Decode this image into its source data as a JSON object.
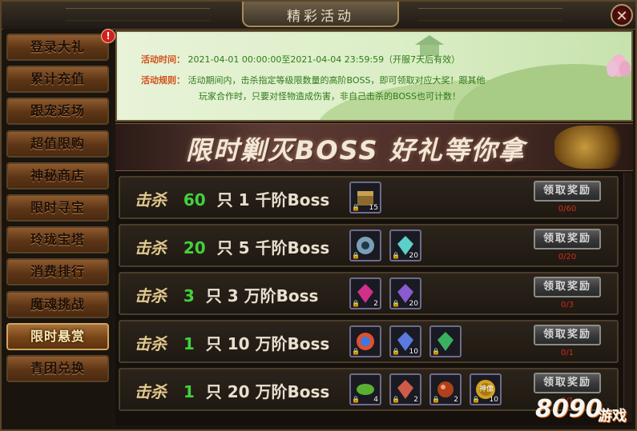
{
  "window": {
    "title": "精彩活动",
    "close_label": "✕"
  },
  "sidebar": {
    "alert": "!",
    "items": [
      {
        "label": "登录大礼"
      },
      {
        "label": "累计充值"
      },
      {
        "label": "跟宠返场"
      },
      {
        "label": "超值限购"
      },
      {
        "label": "神秘商店"
      },
      {
        "label": "限时寻宝"
      },
      {
        "label": "玲珑宝塔"
      },
      {
        "label": "消费排行"
      },
      {
        "label": "魔魂挑战"
      },
      {
        "label": "限时悬赏"
      },
      {
        "label": "青团兑换"
      }
    ],
    "active_index": 9
  },
  "info": {
    "time_label": "活动时间：",
    "time_value": "2021-04-01 00:00:00至2021-04-04 23:59:59（开服7天后有效）",
    "rule_label": "活动规则：",
    "rule_line1_a": "活动期间内，击杀指定等级限数量的高阶BOSS，即可领取对应大奖！",
    "rule_line1_b": "跟其他",
    "rule_line2": "玩家合作时，只要对怪物造成伤害，非自己击杀的BOSS也可计数！"
  },
  "banner": {
    "title": "限时剿灭BOSS  好礼等你拿"
  },
  "rewards": [
    {
      "kill": "击杀",
      "count": "60",
      "unit": "只",
      "level": "1",
      "tier": "千阶Boss",
      "button": "领取奖励",
      "progress": "0/60",
      "items": [
        {
          "icon": "treasure-chest-icon",
          "count": "15",
          "color": "#8a6a2e"
        }
      ]
    },
    {
      "kill": "击杀",
      "count": "20",
      "unit": "只",
      "level": "5",
      "tier": "千阶Boss",
      "button": "领取奖励",
      "progress": "0/20",
      "items": [
        {
          "icon": "compass-icon",
          "count": "",
          "color": "#7aa0b8"
        },
        {
          "icon": "cyan-crystal-icon",
          "count": "20",
          "color": "#5ad0c8"
        }
      ]
    },
    {
      "kill": "击杀",
      "count": "3",
      "unit": "只",
      "level": "3",
      "tier": "万阶Boss",
      "button": "领取奖励",
      "progress": "0/3",
      "items": [
        {
          "icon": "pink-gem-icon",
          "count": "2",
          "color": "#d0308a"
        },
        {
          "icon": "purple-crystal-icon",
          "count": "20",
          "color": "#8a5ad0"
        }
      ]
    },
    {
      "kill": "击杀",
      "count": "1",
      "unit": "只",
      "level": "10",
      "tier": "万阶Boss",
      "button": "领取奖励",
      "progress": "0/1",
      "items": [
        {
          "icon": "rainbow-orb-icon",
          "count": "",
          "color": "#e05030"
        },
        {
          "icon": "blue-feather-icon",
          "count": "10",
          "color": "#5a7ae0"
        },
        {
          "icon": "green-crystal-icon",
          "count": "",
          "color": "#3ab060"
        }
      ]
    },
    {
      "kill": "击杀",
      "count": "1",
      "unit": "只",
      "level": "20",
      "tier": "万阶Boss",
      "button": "领取奖励",
      "progress": "0/1",
      "items": [
        {
          "icon": "green-leaf-icon",
          "count": "4",
          "color": "#5ab030"
        },
        {
          "icon": "red-crystal-icon",
          "count": "2",
          "color": "#d05a4a"
        },
        {
          "icon": "red-orb-icon",
          "count": "2",
          "color": "#b0401a"
        },
        {
          "icon": "gold-coin-icon",
          "count": "10",
          "color": "#d4a020",
          "text": "神像"
        }
      ]
    }
  ],
  "watermark": {
    "num": "8090",
    "cn": "游戏"
  }
}
